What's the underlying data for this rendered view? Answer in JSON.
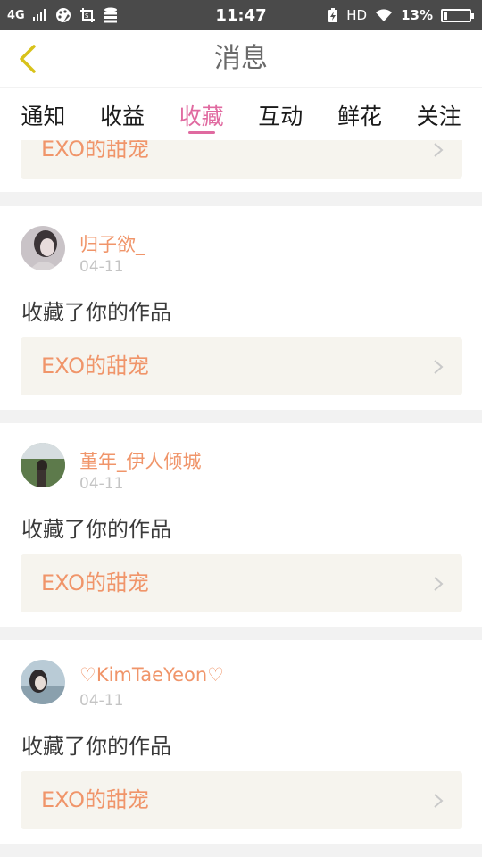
{
  "status_bar": {
    "network": "4G",
    "time": "11:47",
    "hd": "HD",
    "battery_pct": "13%",
    "battery_level": 0.13,
    "icons": [
      "signal-icon",
      "palette-icon",
      "screenshot-icon",
      "storage-icon",
      "battery-charge-icon",
      "wifi-icon",
      "battery-icon"
    ]
  },
  "header": {
    "title": "消息",
    "back_icon": "chevron-left-icon",
    "back_color": "#d8c21a"
  },
  "tabs": [
    {
      "label": "通知",
      "active": false
    },
    {
      "label": "收益",
      "active": false
    },
    {
      "label": "收藏",
      "active": true
    },
    {
      "label": "互动",
      "active": false
    },
    {
      "label": "鲜花",
      "active": false
    },
    {
      "label": "关注",
      "active": false
    }
  ],
  "colors": {
    "accent": "#e06aa0",
    "username": "#f0956a",
    "work_title": "#f0956a",
    "date": "#c4c4c4",
    "background": "#f2f2f2",
    "work_box": "#f6f4ee"
  },
  "partial_card": {
    "work_title": "EXO的甜宠"
  },
  "cards": [
    {
      "username": "归子欲_",
      "date": "04-11",
      "action": "收藏了你的作品",
      "work_title": "EXO的甜宠"
    },
    {
      "username": "堇年_伊人倾城",
      "date": "04-11",
      "action": "收藏了你的作品",
      "work_title": "EXO的甜宠"
    },
    {
      "username": "♡KimTaeYeon♡",
      "date": "04-11",
      "action": "收藏了你的作品",
      "work_title": "EXO的甜宠"
    }
  ]
}
